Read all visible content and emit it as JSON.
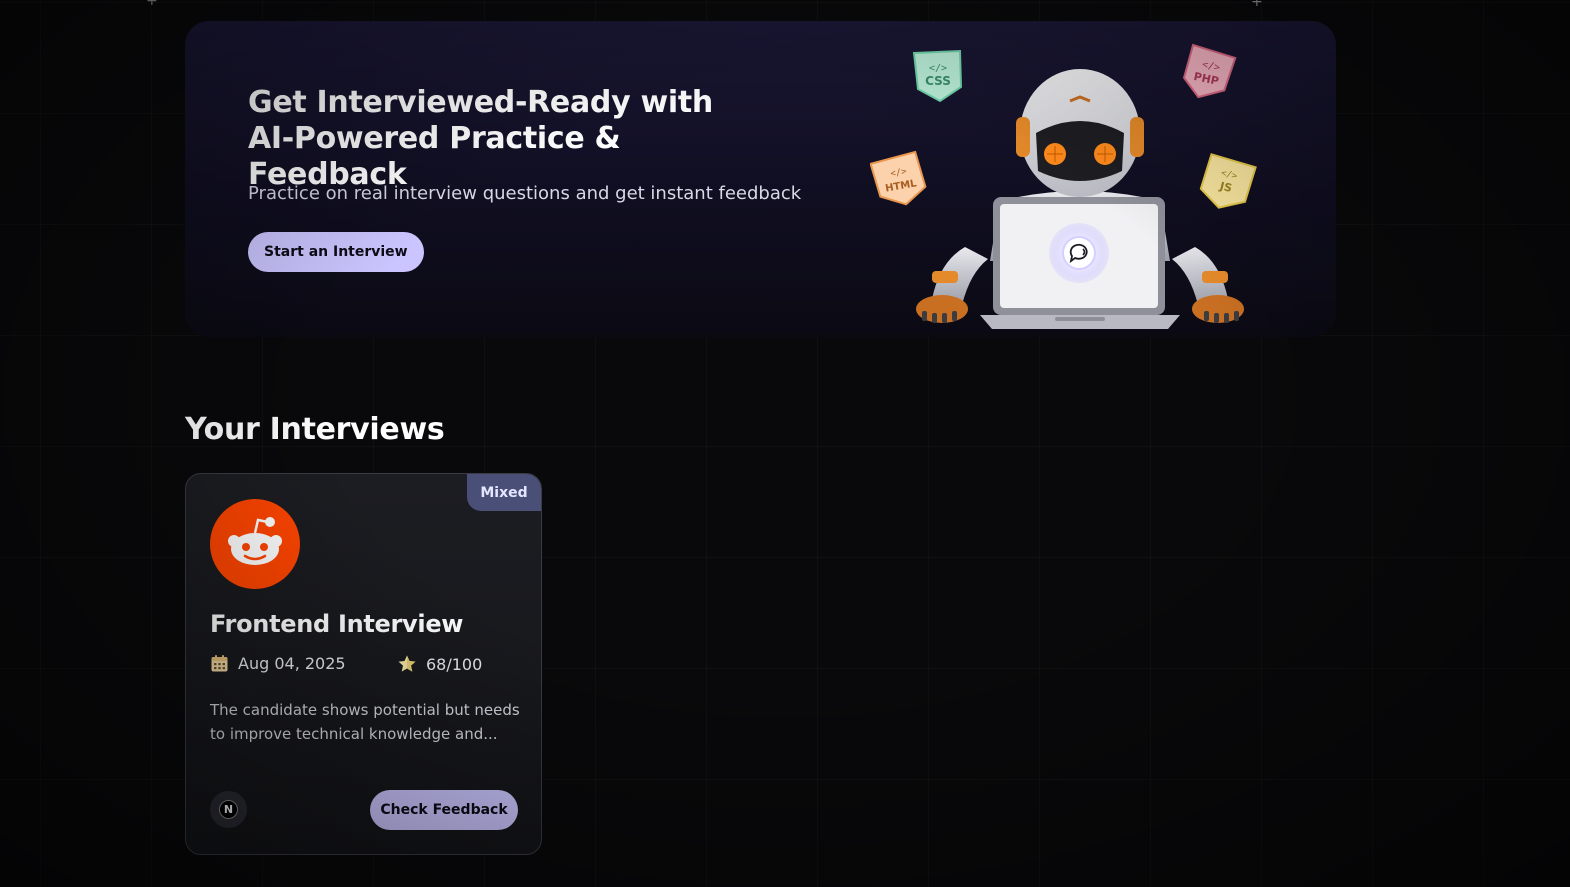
{
  "hero": {
    "title": "Get Interviewed-Ready with AI-Powered Practice & Feedback",
    "subtitle": "Practice on real interview questions and get instant feedback",
    "cta_label": "Start an Interview",
    "illustration": {
      "icon": "robot-laptop-illustration",
      "tags": [
        "CSS",
        "PHP",
        "HTML",
        "JS"
      ]
    }
  },
  "interviews": {
    "section_title": "Your Interviews",
    "cards": [
      {
        "type_badge": "Mixed",
        "logo_icon": "reddit-logo-icon",
        "logo_color": "#ff4500",
        "title": "Frontend Interview",
        "date": "Aug 04, 2025",
        "score": "68/100",
        "description": "The candidate shows potential but needs to improve technical knowledge and...",
        "tech_icon": "nextjs-icon",
        "cta_label": "Check Feedback"
      }
    ]
  },
  "colors": {
    "background": "#09090b",
    "accent": "#cac5fe",
    "badge": "#4a4f78"
  }
}
